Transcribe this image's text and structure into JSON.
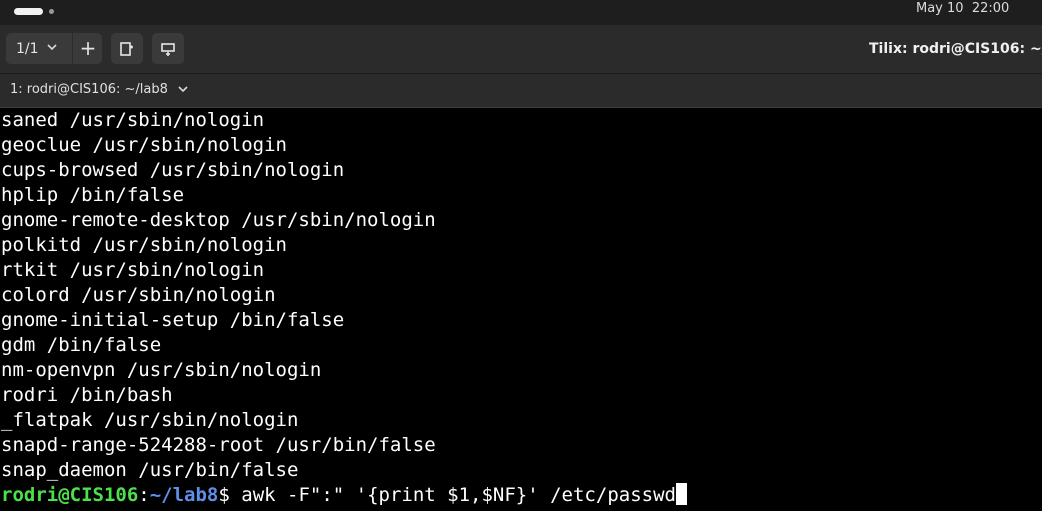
{
  "topbar": {
    "clock": "May 10  22:00"
  },
  "header": {
    "session_label": "1/1",
    "add_label": "+",
    "window_title": "Tilix: rodri@CIS106: ~/lab"
  },
  "tab": {
    "title": "1: rodri@CIS106: ~/lab8"
  },
  "terminal": {
    "lines": [
      "saned /usr/sbin/nologin",
      "geoclue /usr/sbin/nologin",
      "cups-browsed /usr/sbin/nologin",
      "hplip /bin/false",
      "gnome-remote-desktop /usr/sbin/nologin",
      "polkitd /usr/sbin/nologin",
      "rtkit /usr/sbin/nologin",
      "colord /usr/sbin/nologin",
      "gnome-initial-setup /bin/false",
      "gdm /bin/false",
      "nm-openvpn /usr/sbin/nologin",
      "rodri /bin/bash",
      "_flatpak /usr/sbin/nologin",
      "snapd-range-524288-root /usr/bin/false",
      "snap_daemon /usr/bin/false"
    ],
    "prompt": {
      "user_host": "rodri@CIS106",
      "separator": ":",
      "path": "~/lab8",
      "symbol": "$ ",
      "command": "awk -F\":\" '{print $1,$NF}' /etc/passwd"
    }
  },
  "colors": {
    "prompt_user": "#4ee04a",
    "prompt_path": "#5f8fe6",
    "terminal_bg": "#000000",
    "terminal_fg": "#ffffff"
  }
}
